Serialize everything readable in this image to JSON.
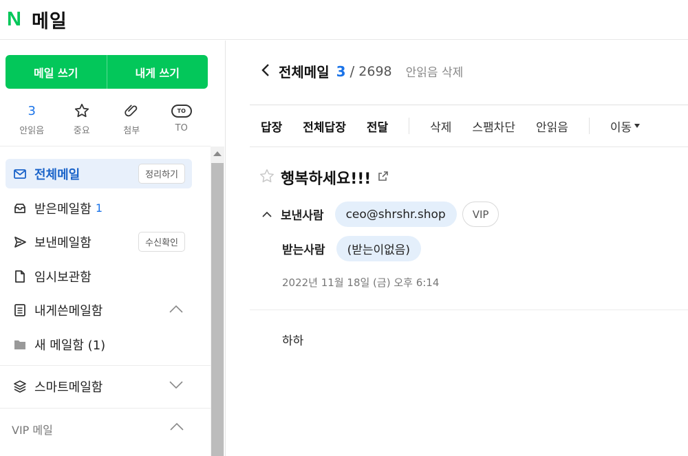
{
  "app": {
    "logo_letter": "N",
    "title": "메일"
  },
  "sidebar": {
    "compose": {
      "write_label": "메일 쓰기",
      "self_label": "내게 쓰기"
    },
    "quick": [
      {
        "value": "3",
        "label": "안읽음"
      },
      {
        "icon": "star-icon",
        "label": "중요"
      },
      {
        "icon": "paperclip-icon",
        "label": "첨부"
      },
      {
        "icon_text": "TO",
        "label": "TO"
      }
    ],
    "folders": [
      {
        "icon": "envelope-icon",
        "label": "전체메일",
        "button": "정리하기"
      },
      {
        "icon": "inbox-icon",
        "label": "받은메일함",
        "count": "1"
      },
      {
        "icon": "send-icon",
        "label": "보낸메일함",
        "button": "수신확인"
      },
      {
        "icon": "document-icon",
        "label": "임시보관함"
      },
      {
        "icon": "list-document-icon",
        "label": "내게쓴메일함"
      },
      {
        "icon": "folder-icon",
        "label": "새 메일함 (1)"
      },
      {
        "icon": "layers-icon",
        "label": "스마트메일함"
      }
    ],
    "vip_label": "VIP 메일"
  },
  "main": {
    "breadcrumb": {
      "title": "전체메일",
      "unread": "3",
      "slash": "/",
      "total": "2698",
      "action": "안읽음 삭제"
    },
    "toolbar": {
      "reply": "답장",
      "reply_all": "전체답장",
      "forward": "전달",
      "delete": "삭제",
      "spam": "스팸차단",
      "mark_unread": "안읽음",
      "move": "이동"
    },
    "mail": {
      "subject": "행복하세요!!!",
      "from_label": "보낸사람",
      "from": "ceo@shrshr.shop",
      "vip": "VIP",
      "to_label": "받는사람",
      "to": "(받는이없음)",
      "date": "2022년 11월 18일 (금) 오후 6:14",
      "body": "하하"
    }
  },
  "colors": {
    "brand_green": "#03c75a",
    "accent_blue": "#1a73e8",
    "chip_blue": "#e4effb"
  }
}
